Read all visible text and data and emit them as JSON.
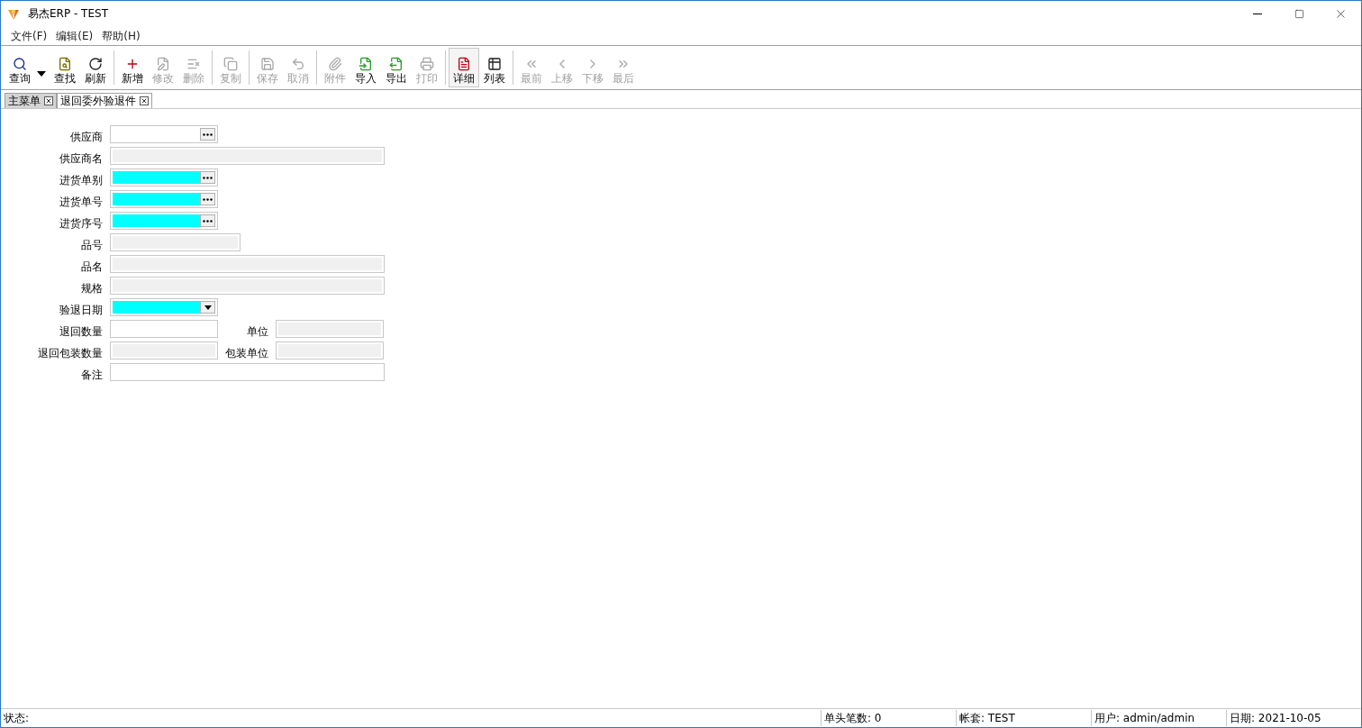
{
  "window": {
    "title": "易杰ERP - TEST"
  },
  "menu": [
    "文件(F)",
    "编辑(E)",
    "帮助(H)"
  ],
  "toolbar": [
    [
      {
        "label": "查询",
        "kind": "query",
        "disabled": false,
        "selected": false,
        "dropdown": true
      },
      {
        "label": "查找",
        "kind": "find",
        "disabled": false,
        "selected": false
      },
      {
        "label": "刷新",
        "kind": "refresh",
        "disabled": false,
        "selected": false
      }
    ],
    [
      {
        "label": "新增",
        "kind": "add",
        "disabled": false,
        "selected": false
      },
      {
        "label": "修改",
        "kind": "edit",
        "disabled": true,
        "selected": false
      },
      {
        "label": "删除",
        "kind": "delete",
        "disabled": true,
        "selected": false
      }
    ],
    [
      {
        "label": "复制",
        "kind": "copy",
        "disabled": true,
        "selected": false
      }
    ],
    [
      {
        "label": "保存",
        "kind": "save",
        "disabled": true,
        "selected": false
      },
      {
        "label": "取消",
        "kind": "undo",
        "disabled": true,
        "selected": false
      }
    ],
    [
      {
        "label": "附件",
        "kind": "attach",
        "disabled": true,
        "selected": false
      },
      {
        "label": "导入",
        "kind": "import",
        "disabled": false,
        "selected": false
      },
      {
        "label": "导出",
        "kind": "export",
        "disabled": false,
        "selected": false
      },
      {
        "label": "打印",
        "kind": "print",
        "disabled": true,
        "selected": false
      }
    ],
    [
      {
        "label": "详细",
        "kind": "detail",
        "disabled": false,
        "selected": true
      },
      {
        "label": "列表",
        "kind": "list",
        "disabled": false,
        "selected": false
      }
    ],
    [
      {
        "label": "最前",
        "kind": "first",
        "disabled": true,
        "selected": false
      },
      {
        "label": "上移",
        "kind": "prev",
        "disabled": true,
        "selected": false
      },
      {
        "label": "下移",
        "kind": "next",
        "disabled": true,
        "selected": false
      },
      {
        "label": "最后",
        "kind": "last",
        "disabled": true,
        "selected": false
      }
    ]
  ],
  "tabs": [
    {
      "label": "主菜单",
      "selected": false
    },
    {
      "label": "退回委外验退件",
      "selected": true
    }
  ],
  "form": [
    [
      {
        "label": "供应商",
        "kind": "lookup",
        "required": false
      }
    ],
    [
      {
        "label": "供应商名",
        "kind": "readonly",
        "required": false
      }
    ],
    [
      {
        "label": "进货单别",
        "kind": "lookup",
        "required": true
      }
    ],
    [
      {
        "label": "进货单号",
        "kind": "lookup",
        "required": true
      }
    ],
    [
      {
        "label": "进货序号",
        "kind": "lookup",
        "required": true
      }
    ],
    [
      {
        "label": "品号",
        "kind": "readonly",
        "required": false
      }
    ],
    [
      {
        "label": "品名",
        "kind": "readonly",
        "required": false
      }
    ],
    [
      {
        "label": "规格",
        "kind": "readonly",
        "required": false
      }
    ],
    [
      {
        "label": "验退日期",
        "kind": "date",
        "required": true
      }
    ],
    [
      {
        "label": "退回数量",
        "kind": "text",
        "required": false
      },
      {
        "label": "单位",
        "kind": "readonly",
        "required": false
      }
    ],
    [
      {
        "label": "退回包装数量",
        "kind": "readonly",
        "required": false
      },
      {
        "label": "包装单位",
        "kind": "readonly",
        "required": false
      }
    ],
    [
      {
        "label": "备注",
        "kind": "text",
        "required": false
      }
    ]
  ],
  "status_bar": {
    "label": "状态:",
    "panels": [
      "单头笔数: 0",
      "帐套: TEST",
      "用户: admin/admin",
      "日期: 2021-10-05"
    ]
  }
}
